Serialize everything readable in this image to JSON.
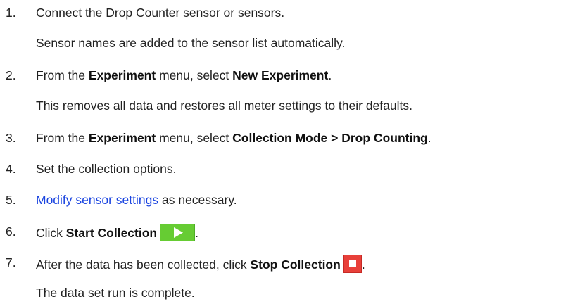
{
  "steps": [
    {
      "number": "1.",
      "text": "Connect the Drop Counter sensor or sensors.",
      "note": "Sensor names are added to the sensor list automatically."
    },
    {
      "number": "2.",
      "pre": "From the ",
      "bold1": "Experiment",
      "mid": " menu, select ",
      "bold2": "New Experiment",
      "post": ".",
      "note": "This removes all data and restores all meter settings to their defaults."
    },
    {
      "number": "3.",
      "pre": "From the ",
      "bold1": "Experiment",
      "mid": " menu, select ",
      "bold2": "Collection Mode > Drop Counting",
      "post": "."
    },
    {
      "number": "4.",
      "text": "Set the collection options."
    },
    {
      "number": "5.",
      "link": "Modify sensor settings",
      "post": " as necessary."
    },
    {
      "number": "6.",
      "pre": "Click ",
      "bold": "Start Collection",
      "post": "."
    },
    {
      "number": "7.",
      "pre": "After the data has been collected, click ",
      "bold": "Stop Collection",
      "post": ".",
      "note": "The data set run is complete."
    }
  ],
  "colors": {
    "text": "#222222",
    "link": "#1a44e0",
    "start_button": "#66cc33",
    "stop_button": "#e8403a"
  },
  "icons": {
    "start": "play-icon",
    "stop": "stop-icon"
  }
}
